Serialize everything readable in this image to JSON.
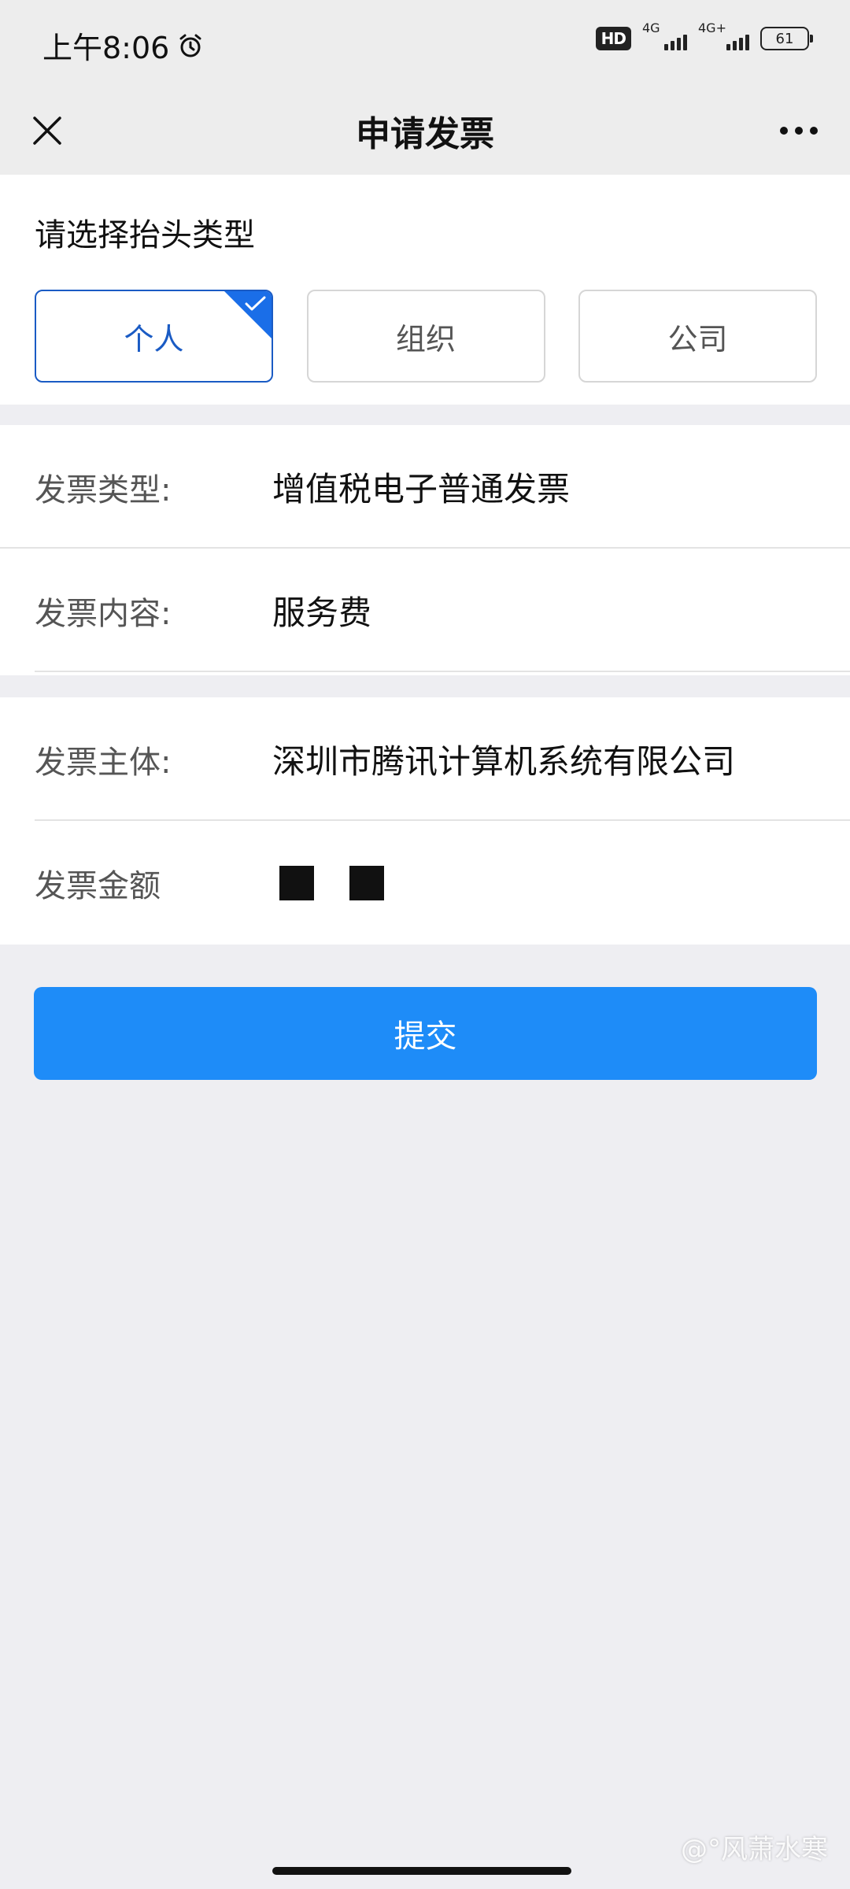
{
  "status_bar": {
    "time": "上午8:06",
    "hd_label": "HD",
    "network_1": "4G",
    "network_2": "4G+",
    "battery": "61"
  },
  "nav": {
    "title": "申请发票"
  },
  "header_type": {
    "heading": "请选择抬头类型",
    "options": [
      {
        "label": "个人",
        "selected": true
      },
      {
        "label": "组织",
        "selected": false
      },
      {
        "label": "公司",
        "selected": false
      }
    ]
  },
  "invoice": {
    "type_label": "发票类型:",
    "type_value": "增值税电子普通发票",
    "content_label": "发票内容:",
    "content_value": "服务费",
    "issuer_label": "发票主体:",
    "issuer_value": "深圳市腾讯计算机系统有限公司",
    "amount_label": "发票金额"
  },
  "actions": {
    "submit_label": "提交"
  },
  "watermark": "@°风萧水寒",
  "colors": {
    "accent": "#1E8CF8",
    "selected_border": "#1A5BC4",
    "page_bg": "#EEEEF2"
  }
}
